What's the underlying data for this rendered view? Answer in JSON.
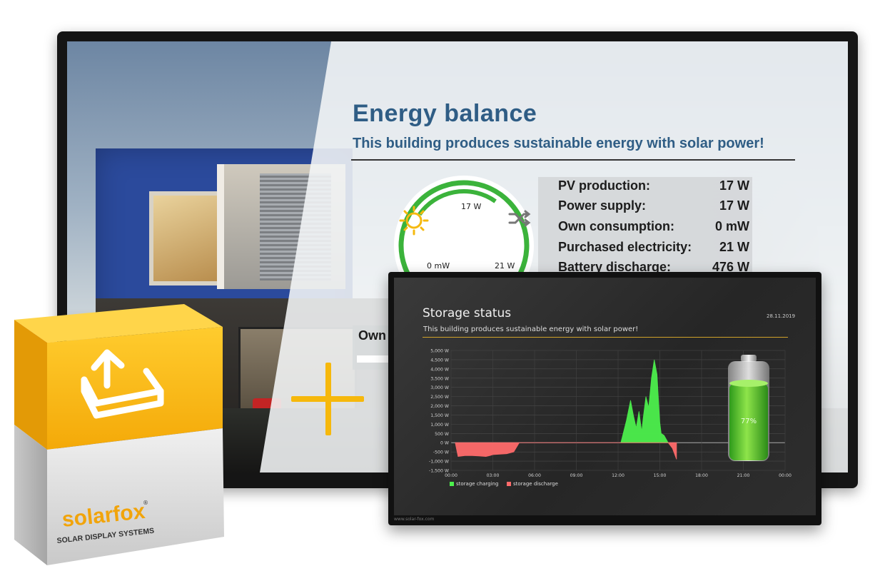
{
  "energy_balance": {
    "title": "Energy balance",
    "subtitle": "This building produces sustainable energy with solar power!",
    "stats": [
      {
        "label": "PV production:",
        "value": "17 W"
      },
      {
        "label": "Power supply:",
        "value": "17 W"
      },
      {
        "label": "Own consumption:",
        "value": "0 mW"
      },
      {
        "label": "Purchased electricity:",
        "value": "21 W"
      },
      {
        "label": "Battery discharge:",
        "value": "476 W"
      }
    ],
    "gauge": {
      "top_value": "17 W",
      "left_value": "0 mW",
      "right_value": "21 W"
    },
    "own_label": "Own c",
    "icons": [
      "sun-icon",
      "shuffle-icon"
    ],
    "colors": {
      "title": "#2f5d85",
      "gauge_ring": "#3bb33b",
      "sun": "#f5b90f"
    }
  },
  "storage_status": {
    "title": "Storage status",
    "date": "28.11.2019",
    "subtitle": "This building produces sustainable energy with solar power!",
    "battery_percent": "77%",
    "footer": "www.solar-fox.com",
    "colors": {
      "charging": "#4cf04c",
      "discharge": "#ff6b6b",
      "rule": "#d0a229"
    }
  },
  "chart_data": {
    "type": "area",
    "title": "",
    "xlabel": "",
    "ylabel": "",
    "x_ticks": [
      "00:00",
      "03:00",
      "06:00",
      "09:00",
      "12:00",
      "15:00",
      "18:00",
      "21:00",
      "00:00"
    ],
    "y_ticks": [
      "5,000 W",
      "4,500 W",
      "4,000 W",
      "3,500 W",
      "3,000 W",
      "2,500 W",
      "2,000 W",
      "1,500 W",
      "1,000 W",
      "500 W",
      "0 W",
      "-500 W",
      "-1,000 W",
      "-1,500 W"
    ],
    "ylim": [
      -1500,
      5000
    ],
    "xlim": [
      0,
      24
    ],
    "legend_position": "bottom-left",
    "series": [
      {
        "name": "storage charging",
        "color": "#4cf04c",
        "x": [
          12.2,
          12.6,
          12.9,
          13.1,
          13.3,
          13.5,
          13.7,
          13.8,
          14.0,
          14.2,
          14.4,
          14.6,
          14.8,
          15.0,
          15.1,
          15.3,
          15.6
        ],
        "y": [
          0,
          1200,
          2300,
          1500,
          800,
          1700,
          600,
          1300,
          2500,
          1900,
          3500,
          4500,
          3700,
          1100,
          500,
          400,
          0
        ]
      },
      {
        "name": "storage discharge",
        "color": "#ff6b6b",
        "x": [
          0.3,
          0.5,
          1.0,
          1.5,
          2.0,
          2.5,
          2.8,
          3.0,
          3.5,
          4.0,
          4.5,
          4.9,
          15.6,
          15.9,
          16.1,
          16.2
        ],
        "y": [
          0,
          -750,
          -700,
          -700,
          -720,
          -750,
          -700,
          -650,
          -620,
          -600,
          -500,
          0,
          0,
          -300,
          -700,
          -900
        ]
      }
    ]
  },
  "product_box": {
    "brand": "solarfox",
    "registered": "®",
    "tagline": "SOLAR DISPLAY SYSTEMS",
    "icon": "upload-tray-icon",
    "colors": {
      "yellow": "#f8b80f",
      "grey": "#d9d9d9"
    }
  }
}
